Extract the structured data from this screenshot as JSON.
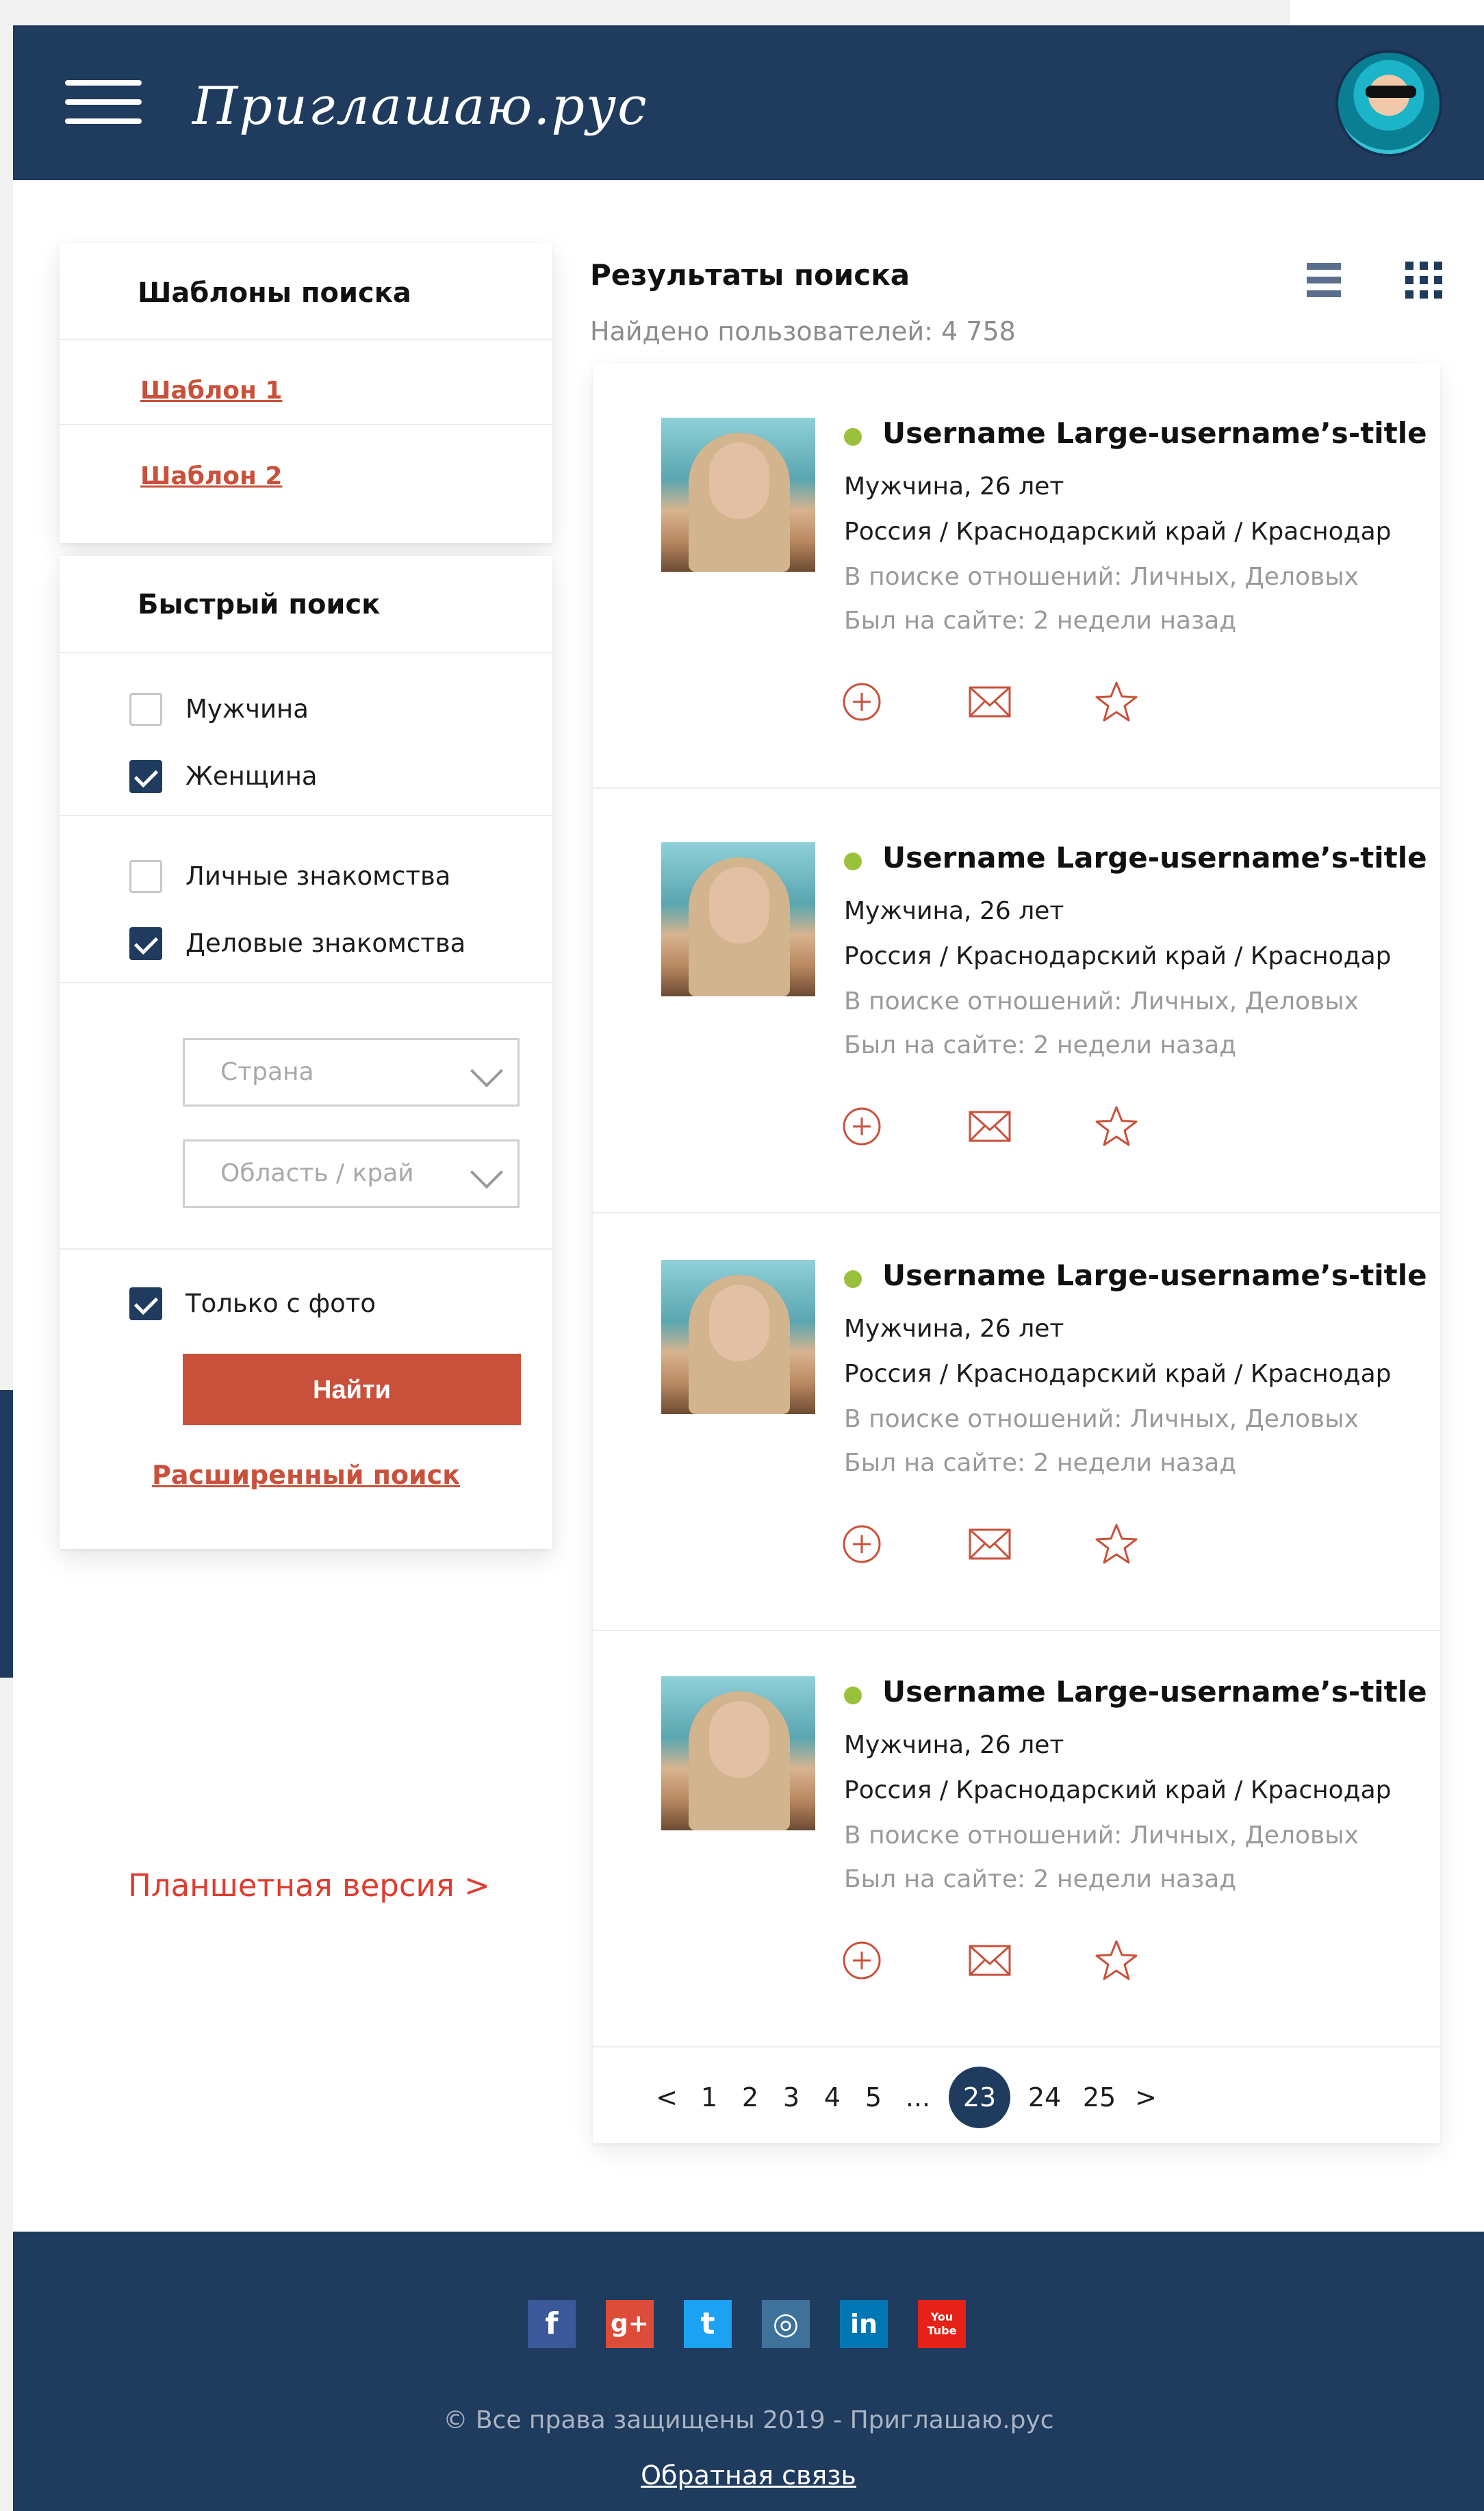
{
  "header": {
    "logo_text": "Приглашаю.рус"
  },
  "templates": {
    "title": "Шаблоны поиска",
    "items": [
      "Шаблон 1",
      "Шаблон 2"
    ]
  },
  "quick_search": {
    "title": "Быстрый поиск",
    "gender": [
      {
        "label": "Мужчина",
        "checked": false
      },
      {
        "label": "Женщина",
        "checked": true
      }
    ],
    "relations": [
      {
        "label": "Личные знакомства",
        "checked": false
      },
      {
        "label": "Деловые знакомства",
        "checked": true
      }
    ],
    "country_placeholder": "Страна",
    "region_placeholder": "Область / край",
    "photo_only": {
      "label": "Только с фото",
      "checked": true
    },
    "find_button": "Найти",
    "advanced_link": "Расширенный поиск"
  },
  "tablet_link": "Планшетная версия >",
  "results": {
    "title": "Результаты поиска",
    "count": "Найдено пользователей: 4 758",
    "users": [
      {
        "name": "Username Large-username’s-title",
        "gender_age": "Мужчина, 26 лет",
        "location": "Россия / Краснодарский край / Краснодар",
        "looking": "В поиске отношений: Личных, Деловых",
        "last_seen": "Был на сайте: 2 недели назад"
      },
      {
        "name": "Username Large-username’s-title",
        "gender_age": "Мужчина, 26 лет",
        "location": "Россия / Краснодарский край / Краснодар",
        "looking": "В поиске отношений: Личных, Деловых",
        "last_seen": "Был на сайте: 2 недели назад"
      },
      {
        "name": "Username Large-username’s-title",
        "gender_age": "Мужчина, 26 лет",
        "location": "Россия / Краснодарский край / Краснодар",
        "looking": "В поиске отношений: Личных, Деловых",
        "last_seen": "Был на сайте: 2 недели назад"
      },
      {
        "name": "Username Large-username’s-title",
        "gender_age": "Мужчина, 26 лет",
        "location": "Россия / Краснодарский край / Краснодар",
        "looking": "В поиске отношений: Личных, Деловых",
        "last_seen": "Был на сайте: 2 недели назад"
      }
    ]
  },
  "pagination": {
    "prev": "<",
    "pages": [
      "1",
      "2",
      "3",
      "4",
      "5",
      "...",
      "23",
      "24",
      "25"
    ],
    "current": "23",
    "next": ">"
  },
  "footer": {
    "social": [
      {
        "name": "facebook",
        "label": "f",
        "color": "#3b5998"
      },
      {
        "name": "google-plus",
        "label": "g+",
        "color": "#dd4b39"
      },
      {
        "name": "twitter",
        "label": "t",
        "color": "#1da1f2"
      },
      {
        "name": "instagram",
        "label": "◎",
        "color": "#3f729b"
      },
      {
        "name": "linkedin",
        "label": "in",
        "color": "#0077b5"
      },
      {
        "name": "youtube",
        "label": "You Tube",
        "color": "#e62117"
      }
    ],
    "copyright": "© Все права защищены 2019 - Приглашаю.рус",
    "feedback": "Обратная связь"
  },
  "colors": {
    "primary": "#1f3b5e",
    "accent": "#c9513b",
    "online": "#9ac13b"
  }
}
